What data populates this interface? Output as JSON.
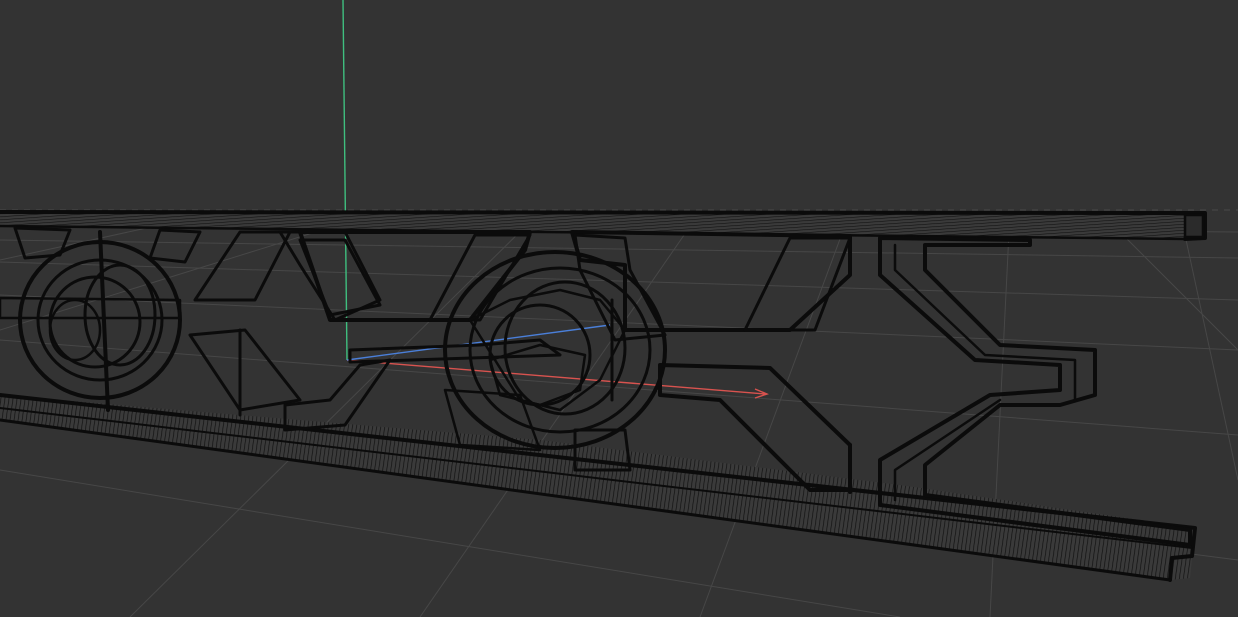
{
  "viewport": {
    "background_color": "#333333",
    "grid_color": "#474747",
    "mesh_color": "#0b0b0b"
  },
  "axes": {
    "x_axis_color": "#d9534f",
    "y_axis_color": "#3fbf7f",
    "z_axis_color": "#4a7fd9"
  }
}
